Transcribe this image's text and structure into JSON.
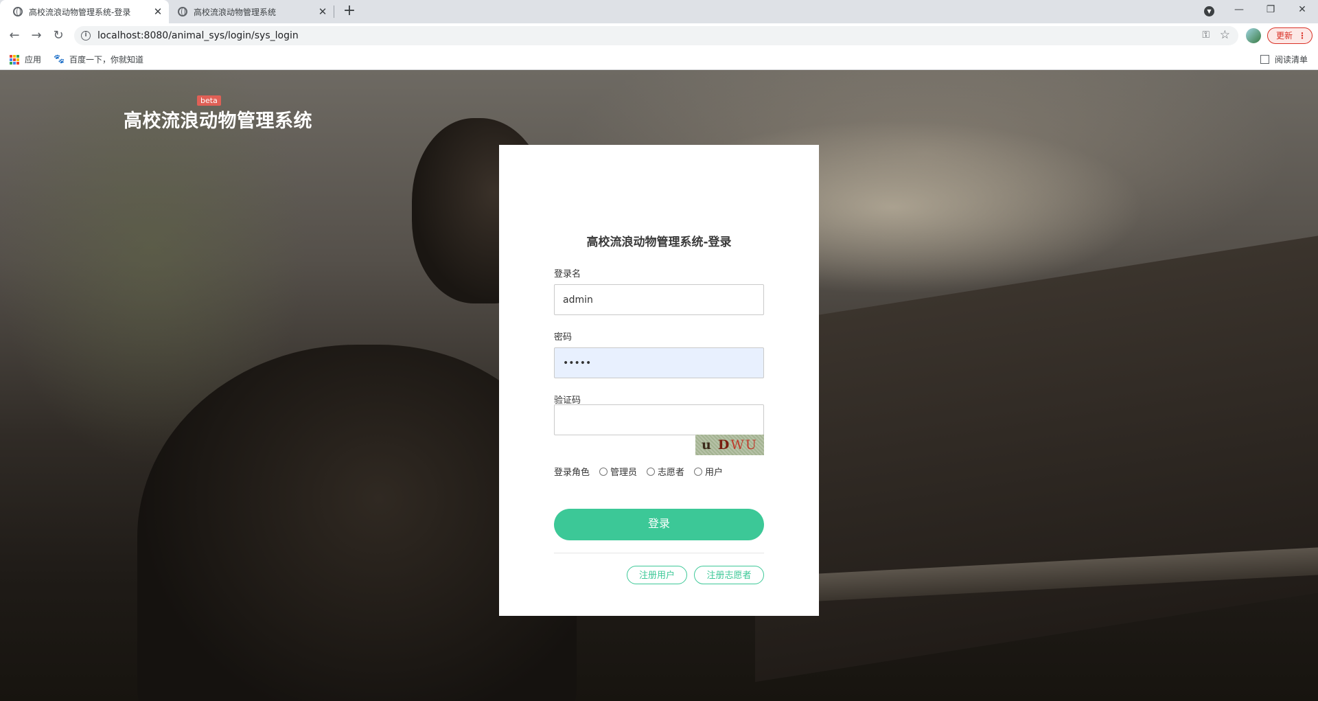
{
  "browser": {
    "tabs": [
      {
        "title": "高校流浪动物管理系统-登录",
        "active": true
      },
      {
        "title": "高校流浪动物管理系统",
        "active": false
      }
    ],
    "url": "localhost:8080/animal_sys/login/sys_login",
    "update_label": "更新",
    "bookmarks": [
      {
        "label": "应用",
        "icon": "apps-icon"
      },
      {
        "label": "百度一下，你就知道",
        "icon": "baidu-paw-icon"
      }
    ],
    "reading_list_label": "阅读清单"
  },
  "page": {
    "brand": "高校流浪动物管理系统",
    "badge": "beta"
  },
  "login": {
    "title": "高校流浪动物管理系统-登录",
    "username_label": "登录名",
    "username_value": "admin",
    "password_label": "密码",
    "password_value": "•••••",
    "captcha_label": "验证码",
    "captcha_value": "",
    "captcha_text": [
      "u",
      "D",
      "WU"
    ],
    "role_label": "登录角色",
    "roles": [
      "管理员",
      "志愿者",
      "用户"
    ],
    "submit_label": "登录",
    "register_user_label": "注册用户",
    "register_volunteer_label": "注册志愿者",
    "accent_color": "#3cc897"
  }
}
